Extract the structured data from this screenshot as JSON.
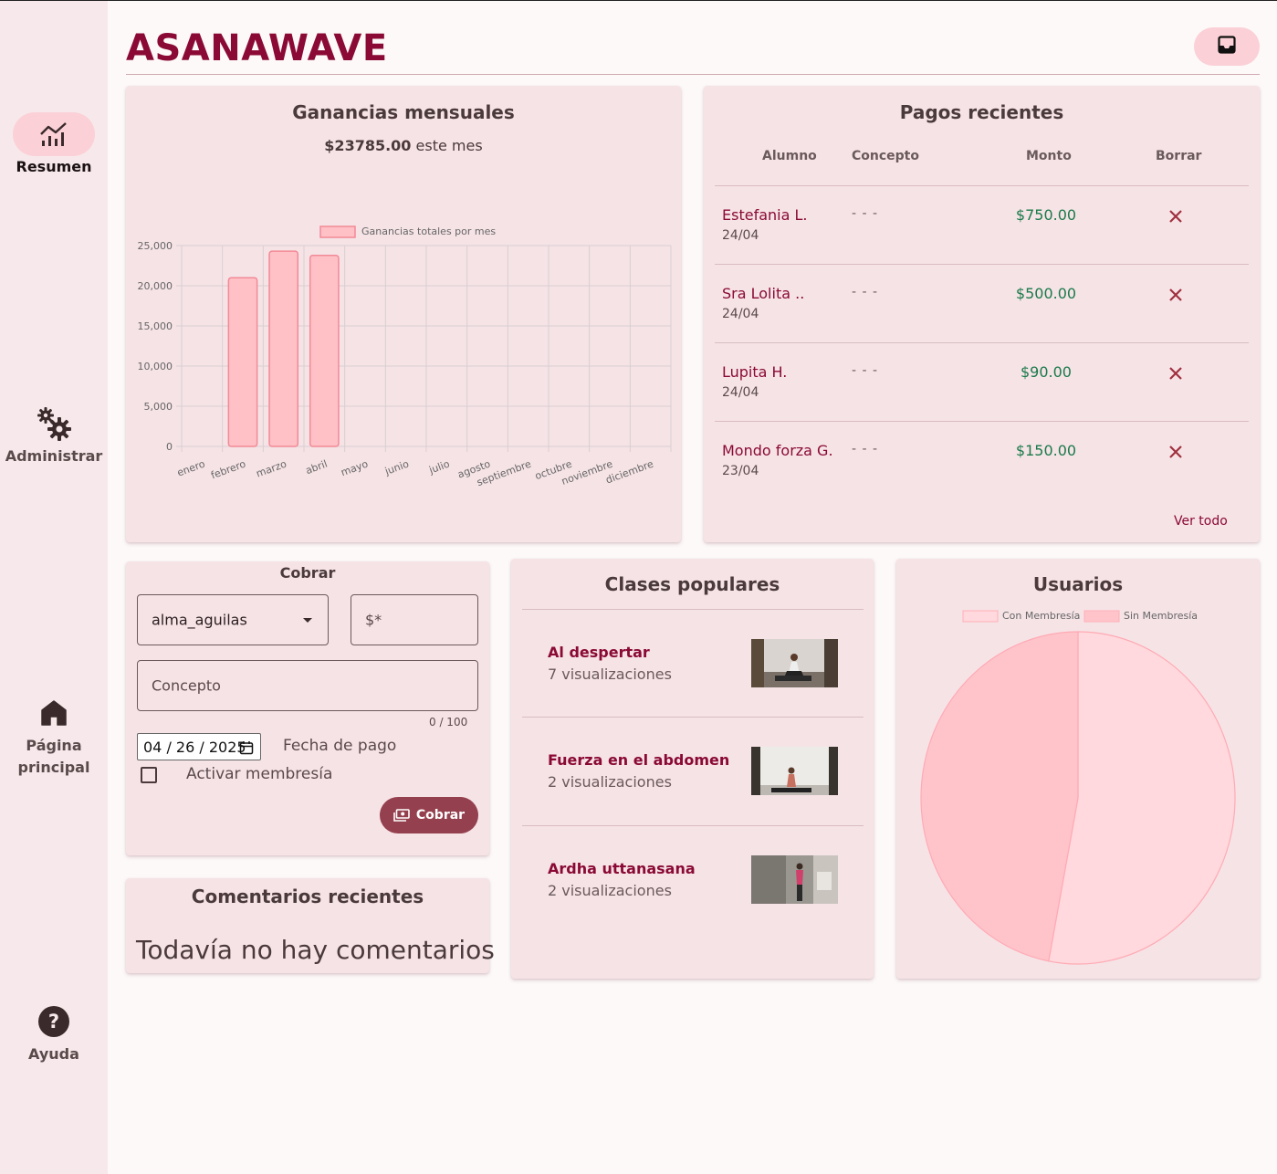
{
  "app": {
    "brand": "ASANAWAVE"
  },
  "sidebar": {
    "items": [
      {
        "label": "Resumen",
        "icon": "chart-line-icon",
        "active": true
      },
      {
        "label": "Administrar",
        "icon": "gears-icon",
        "active": false
      },
      {
        "label_line1": "Página",
        "label_line2": "principal",
        "icon": "home-icon",
        "active": false
      },
      {
        "label": "Ayuda",
        "icon": "help-icon",
        "active": false
      }
    ]
  },
  "header": {
    "inbox_icon": "inbox-icon"
  },
  "revenue": {
    "title": "Ganancias mensuales",
    "amount": "$23785.00",
    "suffix": "este mes"
  },
  "chart_data": [
    {
      "type": "bar",
      "categories": [
        "enero",
        "febrero",
        "marzo",
        "abril",
        "mayo",
        "junio",
        "julio",
        "agosto",
        "septiembre",
        "octubre",
        "noviembre",
        "diciembre"
      ],
      "series": [
        {
          "name": "Ganancias totales por mes",
          "values": [
            0,
            21000,
            24300,
            23785,
            0,
            0,
            0,
            0,
            0,
            0,
            0,
            0
          ]
        }
      ],
      "y_ticks": [
        "0",
        "5,000",
        "10,000",
        "15,000",
        "20,000",
        "25,000"
      ],
      "ylim": [
        0,
        25000
      ],
      "legend": "top",
      "grid": true,
      "bar_color": "#ffc0c6",
      "bar_border": "#f28a96"
    },
    {
      "type": "pie",
      "labels": [
        "Con Membresía",
        "Sin Membresía"
      ],
      "values": [
        53,
        47
      ],
      "colors": [
        "#ffd9dd",
        "#ffc4ca"
      ],
      "legend": "top"
    }
  ],
  "payments": {
    "title": "Pagos recientes",
    "headers": {
      "student": "Alumno",
      "concept": "Concepto",
      "amount": "Monto",
      "delete": "Borrar"
    },
    "rows": [
      {
        "name": "Estefania L.",
        "date": "24/04",
        "concept": "- - -",
        "amount": "$750.00"
      },
      {
        "name": "Sra Lolita ..",
        "date": "24/04",
        "concept": "- - -",
        "amount": "$500.00"
      },
      {
        "name": "Lupita H.",
        "date": "24/04",
        "concept": "- - -",
        "amount": "$90.00"
      },
      {
        "name": "Mondo forza G.",
        "date": "23/04",
        "concept": "- - -",
        "amount": "$150.00"
      }
    ],
    "see_all": "Ver todo"
  },
  "charge": {
    "title": "Cobrar",
    "user_select": "alma_aguilas",
    "amount_placeholder": "$*",
    "concept_placeholder": "Concepto",
    "counter": "0 / 100",
    "date_value": "04 / 26 / 2025",
    "date_label": "Fecha de pago",
    "membership_label": "Activar membresía",
    "submit_label": "Cobrar"
  },
  "popular": {
    "title": "Clases populares",
    "items": [
      {
        "name": "Al despertar",
        "views": "7 visualizaciones"
      },
      {
        "name": "Fuerza en el abdomen",
        "views": "2 visualizaciones"
      },
      {
        "name": "Ardha uttanasana",
        "views": "2 visualizaciones"
      }
    ]
  },
  "users": {
    "title": "Usuarios"
  },
  "comments": {
    "title": "Comentarios recientes",
    "empty": "Todavía no hay comentarios"
  }
}
